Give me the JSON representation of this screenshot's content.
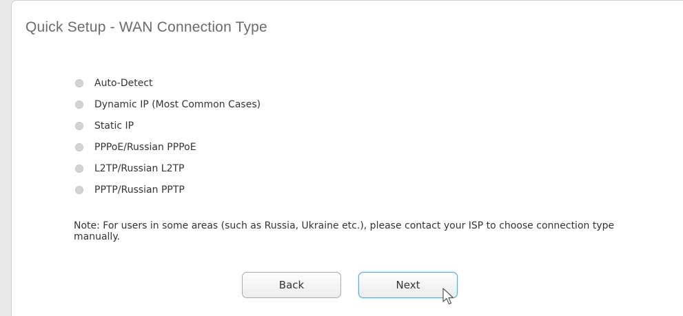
{
  "page": {
    "title": "Quick Setup - WAN Connection Type"
  },
  "options": [
    {
      "label": "Auto-Detect",
      "selected": false
    },
    {
      "label": "Dynamic IP (Most Common Cases)",
      "selected": false
    },
    {
      "label": "Static IP",
      "selected": false
    },
    {
      "label": "PPPoE/Russian PPPoE",
      "selected": false
    },
    {
      "label": "L2TP/Russian L2TP",
      "selected": false
    },
    {
      "label": "PPTP/Russian PPTP",
      "selected": false
    }
  ],
  "note": {
    "prefix": "Note:",
    "text": " For users in some areas (such as Russia, Ukraine etc.), please contact your ISP to choose connection type manually."
  },
  "buttons": {
    "back_label": "Back",
    "next_label": "Next"
  },
  "colors": {
    "accent": "#3fb0dc",
    "title": "#6b6b6b",
    "text": "#333333",
    "radio": "#d4d4d4"
  }
}
